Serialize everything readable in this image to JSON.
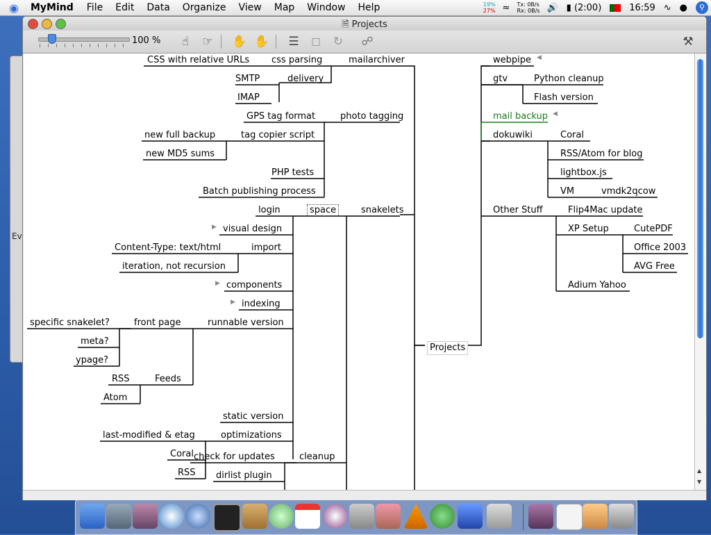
{
  "menubar": {
    "app": "MyMind",
    "items": [
      "File",
      "Edit",
      "Data",
      "Organize",
      "View",
      "Map",
      "Window",
      "Help"
    ],
    "net_cpu": [
      "19%",
      "27%"
    ],
    "net_tx_label": "Tx:",
    "net_rx_label": "Rx:",
    "net_tx": "0B/s",
    "net_rx": "0B/s",
    "battery": "(2:00)",
    "clock": "16:59"
  },
  "window": {
    "title": "Projects",
    "zoom": "100 %"
  },
  "desktop": {
    "bg_window_text": "Ev"
  },
  "map": {
    "root": "Projects",
    "left": {
      "mailarchiver": "mailarchiver",
      "css_parsing": "css parsing",
      "css_rel": "CSS with relative URLs",
      "delivery": "delivery",
      "smtp": "SMTP",
      "imap": "IMAP",
      "photo_tagging": "photo tagging",
      "gps": "GPS tag format",
      "tag_copier": "tag copier script",
      "new_full_backup": "new full backup",
      "new_md5": "new MD5 sums",
      "php_tests": "PHP tests",
      "batch": "Batch publishing process",
      "snakelets": "snakelets",
      "space": "space",
      "login": "login",
      "visual_design": "visual design",
      "import": "import",
      "content_type": "Content-Type: text/html",
      "iteration": "iteration, not recursion",
      "components": "components",
      "indexing": "indexing",
      "runnable": "runnable version",
      "front_page": "front page",
      "specific": "specific snakelet?",
      "meta": "meta?",
      "ypage": "ypage?",
      "feeds": "Feeds",
      "rss1": "RSS",
      "atom": "Atom",
      "static": "static version",
      "optimizations": "optimizations",
      "last_modified": "last-modified & etag",
      "coral": "Coral",
      "check_updates": "check for updates",
      "rss2": "RSS",
      "cleanup": "cleanup",
      "dirlist": "dirlist plugin"
    },
    "right": {
      "webpipe": "webpipe",
      "gtv": "gtv",
      "python_cleanup": "Python cleanup",
      "flash": "Flash version",
      "mail_backup": "mail backup",
      "dokuwiki": "dokuwiki",
      "coral": "Coral",
      "rss_atom": "RSS/Atom for blog",
      "lightbox": "lightbox.js",
      "vm": "VM",
      "vmdk": "vmdk2qcow",
      "other": "Other Stuff",
      "flip4mac": "Flip4Mac update",
      "xp": "XP Setup",
      "cutepdf": "CutePDF",
      "office": "Office 2003",
      "avg": "AVG Free",
      "adium": "Adium Yahoo"
    }
  },
  "colors": {
    "accent": "#2a6bd6",
    "green_node": "#1a7a1a"
  }
}
